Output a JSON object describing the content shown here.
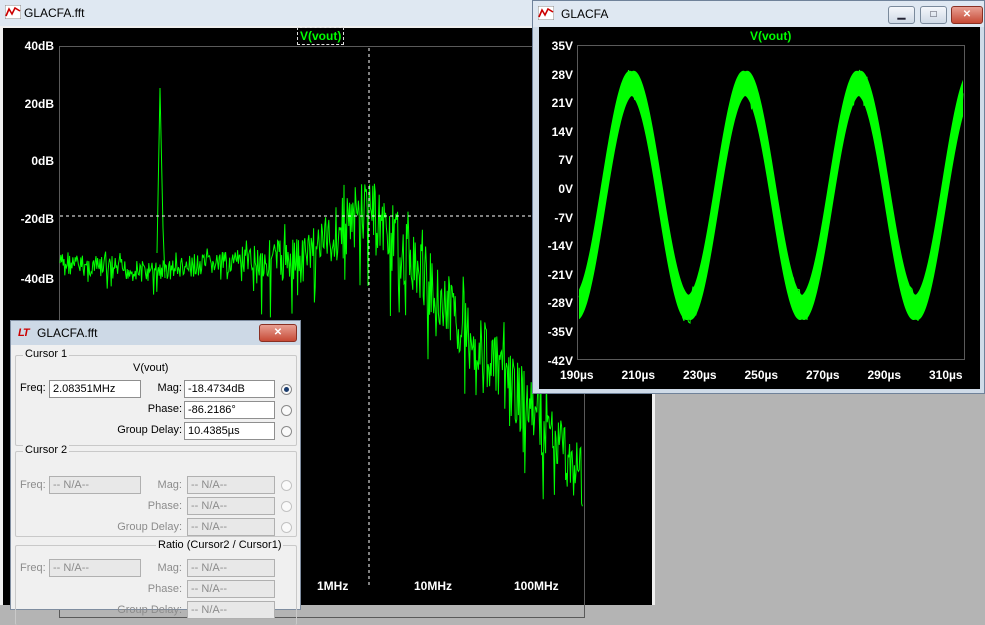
{
  "fft_window": {
    "title": "GLACFA.fft",
    "trace_label": "V(vout)",
    "y_ticks": [
      "40dB",
      "20dB",
      "0dB",
      "-20dB",
      "-40dB"
    ],
    "x_ticks": [
      "1MHz",
      "10MHz",
      "100MHz"
    ]
  },
  "time_window": {
    "title": "GLACFA",
    "trace_label": "V(vout)",
    "y_ticks": [
      "35V",
      "28V",
      "21V",
      "14V",
      "7V",
      "0V",
      "-7V",
      "-14V",
      "-21V",
      "-28V",
      "-35V",
      "-42V"
    ],
    "x_ticks": [
      "190µs",
      "210µs",
      "230µs",
      "250µs",
      "270µs",
      "290µs",
      "310µs"
    ],
    "buttons": {
      "minimize": "▁",
      "maximize": "□",
      "close": "✕"
    }
  },
  "cursor_dialog": {
    "title": "GLACFA.fft",
    "close_label": "✕",
    "logo_text": "LT",
    "cursor1": {
      "group": "Cursor 1",
      "trace": "V(vout)",
      "freq_label": "Freq:",
      "freq": "2.08351MHz",
      "mag_label": "Mag:",
      "mag": "-18.4734dB",
      "phase_label": "Phase:",
      "phase": "-86.2186°",
      "gd_label": "Group Delay:",
      "gd": "10.4385µs"
    },
    "cursor2": {
      "group": "Cursor 2",
      "freq_label": "Freq:",
      "freq": "-- N/A--",
      "mag_label": "Mag:",
      "mag": "-- N/A--",
      "phase_label": "Phase:",
      "phase": "-- N/A--",
      "gd_label": "Group Delay:",
      "gd": "-- N/A--"
    },
    "ratio": {
      "group": "Ratio (Cursor2 / Cursor1)",
      "freq_label": "Freq:",
      "freq": "-- N/A--",
      "mag_label": "Mag:",
      "mag": "-- N/A--",
      "phase_label": "Phase:",
      "phase": "-- N/A--",
      "gd_label": "Group Delay:",
      "gd": "-- N/A--"
    }
  },
  "colors": {
    "trace": "#00ff00",
    "plot_bg": "#000000",
    "grid": "#5a5a5a",
    "cursor": "#ffffff"
  }
}
